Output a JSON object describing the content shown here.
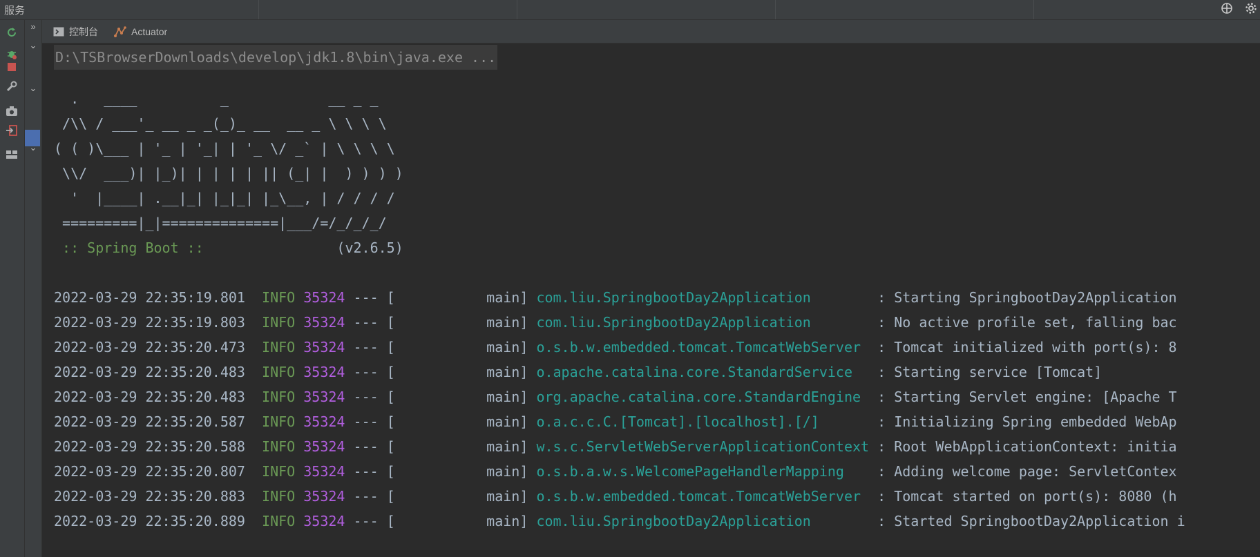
{
  "titlebar": {
    "title": "服务",
    "icons": [
      "target-icon",
      "settings-icon"
    ]
  },
  "left_toolbar": {
    "icons": [
      "rerun-icon",
      "debug-icon",
      "stop-icon",
      "wrench-icon",
      "camera-icon",
      "login-icon",
      "layout-icon"
    ]
  },
  "tree": {
    "icons": [
      "expand-right-icon",
      "chevron-down-icon",
      "chevron-down-icon",
      "chevron-down-icon"
    ]
  },
  "tabs": [
    {
      "label": "控制台",
      "icon": "console-icon"
    },
    {
      "label": "Actuator",
      "icon": "actuator-icon"
    }
  ],
  "console": {
    "command": "D:\\TSBrowserDownloads\\develop\\jdk1.8\\bin\\java.exe ...",
    "banner": [
      "  .   ____          _            __ _ _",
      " /\\\\ / ___'_ __ _ _(_)_ __  __ _ \\ \\ \\ \\",
      "( ( )\\___ | '_ | '_| | '_ \\/ _` | \\ \\ \\ \\",
      " \\\\/  ___)| |_)| | | | | || (_| |  ) ) ) )",
      "  '  |____| .__|_| |_|_| |_\\__, | / / / /",
      " =========|_|==============|___/=/_/_/_/"
    ],
    "spring_label": " :: Spring Boot ::",
    "spring_version": "                (v2.6.5)",
    "colors": {
      "background": "#2b2b2b",
      "text": "#a9b7c6",
      "info": "#6a9955",
      "pid": "#b15ede",
      "logger": "#2aa198"
    },
    "logs": [
      {
        "time": "2022-03-29 22:35:19.801",
        "level": "INFO",
        "pid": "35324",
        "sep": " --- [           main] ",
        "logger": "com.liu.SpringbootDay2Application       ",
        "message": " : Starting SpringbootDay2Application"
      },
      {
        "time": "2022-03-29 22:35:19.803",
        "level": "INFO",
        "pid": "35324",
        "sep": " --- [           main] ",
        "logger": "com.liu.SpringbootDay2Application       ",
        "message": " : No active profile set, falling bac"
      },
      {
        "time": "2022-03-29 22:35:20.473",
        "level": "INFO",
        "pid": "35324",
        "sep": " --- [           main] ",
        "logger": "o.s.b.w.embedded.tomcat.TomcatWebServer ",
        "message": " : Tomcat initialized with port(s): 8"
      },
      {
        "time": "2022-03-29 22:35:20.483",
        "level": "INFO",
        "pid": "35324",
        "sep": " --- [           main] ",
        "logger": "o.apache.catalina.core.StandardService  ",
        "message": " : Starting service [Tomcat]"
      },
      {
        "time": "2022-03-29 22:35:20.483",
        "level": "INFO",
        "pid": "35324",
        "sep": " --- [           main] ",
        "logger": "org.apache.catalina.core.StandardEngine ",
        "message": " : Starting Servlet engine: [Apache T"
      },
      {
        "time": "2022-03-29 22:35:20.587",
        "level": "INFO",
        "pid": "35324",
        "sep": " --- [           main] ",
        "logger": "o.a.c.c.C.[Tomcat].[localhost].[/]      ",
        "message": " : Initializing Spring embedded WebAp"
      },
      {
        "time": "2022-03-29 22:35:20.588",
        "level": "INFO",
        "pid": "35324",
        "sep": " --- [           main] ",
        "logger": "w.s.c.ServletWebServerApplicationContext",
        "message": " : Root WebApplicationContext: initia"
      },
      {
        "time": "2022-03-29 22:35:20.807",
        "level": "INFO",
        "pid": "35324",
        "sep": " --- [           main] ",
        "logger": "o.s.b.a.w.s.WelcomePageHandlerMapping   ",
        "message": " : Adding welcome page: ServletContex"
      },
      {
        "time": "2022-03-29 22:35:20.883",
        "level": "INFO",
        "pid": "35324",
        "sep": " --- [           main] ",
        "logger": "o.s.b.w.embedded.tomcat.TomcatWebServer ",
        "message": " : Tomcat started on port(s): 8080 (h"
      },
      {
        "time": "2022-03-29 22:35:20.889",
        "level": "INFO",
        "pid": "35324",
        "sep": " --- [           main] ",
        "logger": "com.liu.SpringbootDay2Application       ",
        "message": " : Started SpringbootDay2Application i"
      }
    ]
  }
}
